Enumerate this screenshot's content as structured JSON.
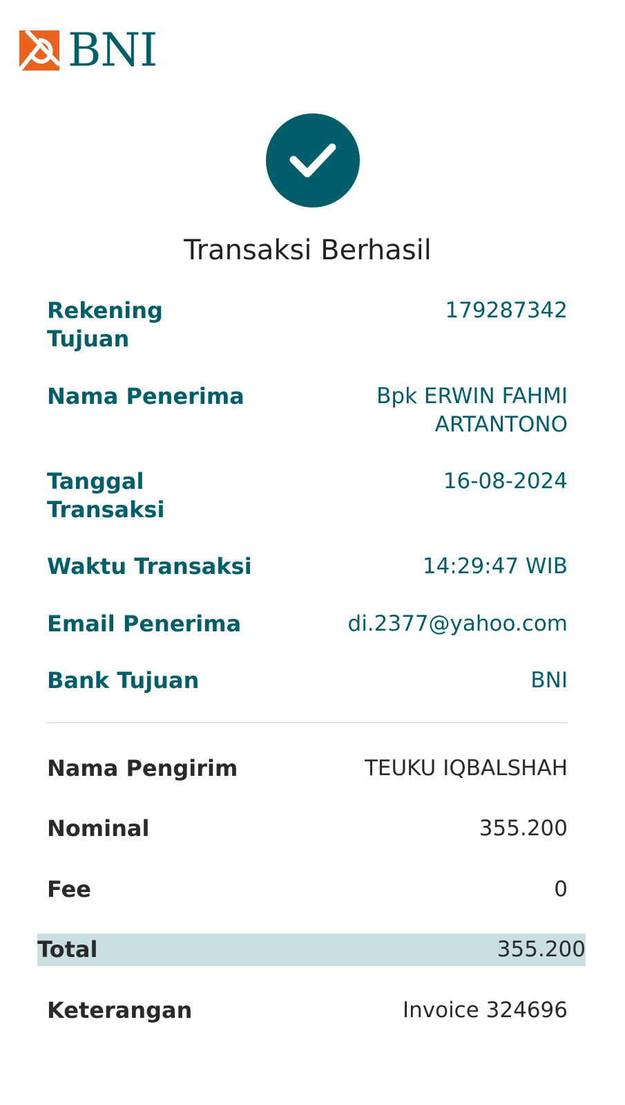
{
  "brand": {
    "name": "BNI",
    "colors": {
      "primary": "#005e6a",
      "accent": "#e9631e",
      "highlight": "#c9dfe1"
    }
  },
  "status": {
    "icon": "check-icon",
    "title": "Transaksi Berhasil"
  },
  "recipient": [
    {
      "label": "Rekening Tujuan",
      "value": "179287342"
    },
    {
      "label": "Nama Penerima",
      "value": "Bpk ERWIN FAHMI ARTANTONO"
    },
    {
      "label": "Tanggal Transaksi",
      "value": "16-08-2024"
    },
    {
      "label": "Waktu Transaksi",
      "value": "14:29:47 WIB"
    },
    {
      "label": "Email Penerima",
      "value": "di.2377@yahoo.com"
    },
    {
      "label": "Bank Tujuan",
      "value": "BNI"
    }
  ],
  "sender": [
    {
      "label": "Nama Pengirim",
      "value": "TEUKU IQBALSHAH"
    },
    {
      "label": "Nominal",
      "value": "355.200"
    },
    {
      "label": "Fee",
      "value": "0"
    }
  ],
  "total": {
    "label": "Total",
    "value": "355.200"
  },
  "note": {
    "label": "Keterangan",
    "value": "Invoice 324696"
  }
}
